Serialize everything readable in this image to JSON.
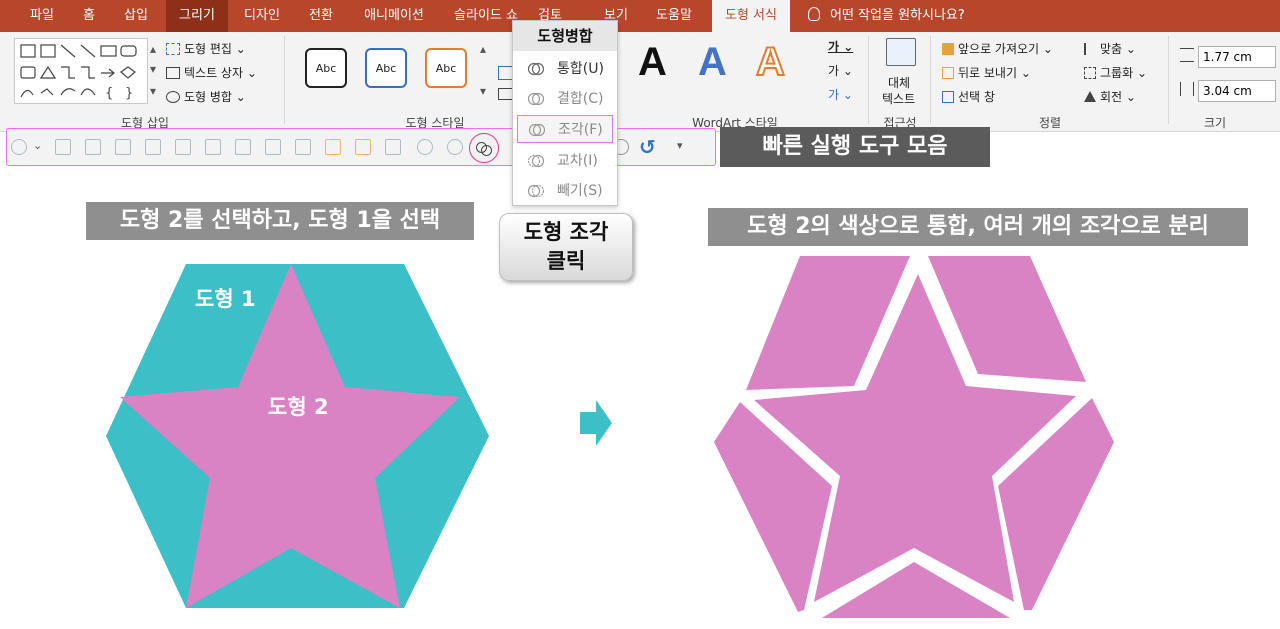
{
  "tabs": [
    {
      "label": "파일"
    },
    {
      "label": "홈"
    },
    {
      "label": "삽입"
    },
    {
      "label": "그리기"
    },
    {
      "label": "디자인"
    },
    {
      "label": "전환"
    },
    {
      "label": "애니메이션"
    },
    {
      "label": "슬라이드 쇼"
    },
    {
      "label": "검토"
    },
    {
      "label": "보기"
    },
    {
      "label": "도움말"
    },
    {
      "label": "도형 서식"
    }
  ],
  "tell_me": "어떤 작업을 원하시나요?",
  "ribbon": {
    "shape_insert": {
      "edit_shape": "도형 편집",
      "text_box": "텍스트 상자",
      "merge_shapes": "도형 병합",
      "label": "도형 삽입"
    },
    "shape_styles": {
      "sample": "Abc",
      "label": "도형 스타일"
    },
    "wordart": {
      "letter": "A",
      "label": "WordArt 스타일"
    },
    "accessibility": {
      "alt_text_1": "대체",
      "alt_text_2": "텍스트",
      "label": "접근성"
    },
    "arrange": {
      "bring_forward": "앞으로 가져오기",
      "send_backward": "뒤로 보내기",
      "selection_pane": "선택 창",
      "align": "맞춤",
      "group": "그룹화",
      "rotate": "회전",
      "label": "정렬"
    },
    "size": {
      "height": "1.77 cm",
      "width": "3.04 cm",
      "label": "크기"
    }
  },
  "merge_menu": {
    "title": "도형병합",
    "items": [
      {
        "label": "통합(U)"
      },
      {
        "label": "결합(C)"
      },
      {
        "label": "조각(F)"
      },
      {
        "label": "교차(I)"
      },
      {
        "label": "빼기(S)"
      }
    ]
  },
  "qat_label": "빠른 실행 도구 모음",
  "captions": {
    "left": "도형 2를 선택하고, 도형 1을 선택",
    "button_line1": "도형 조각",
    "button_line2": "클릭",
    "right": "도형 2의 색상으로 통합, 여러 개의 조각으로 분리"
  },
  "shapes": {
    "shape1": "도형 1",
    "shape2": "도형 2"
  },
  "colors": {
    "ribbon_red": "#b7472a",
    "teal": "#3dbfc8",
    "pink": "#d982c4",
    "highlight": "#ee6ff0"
  }
}
